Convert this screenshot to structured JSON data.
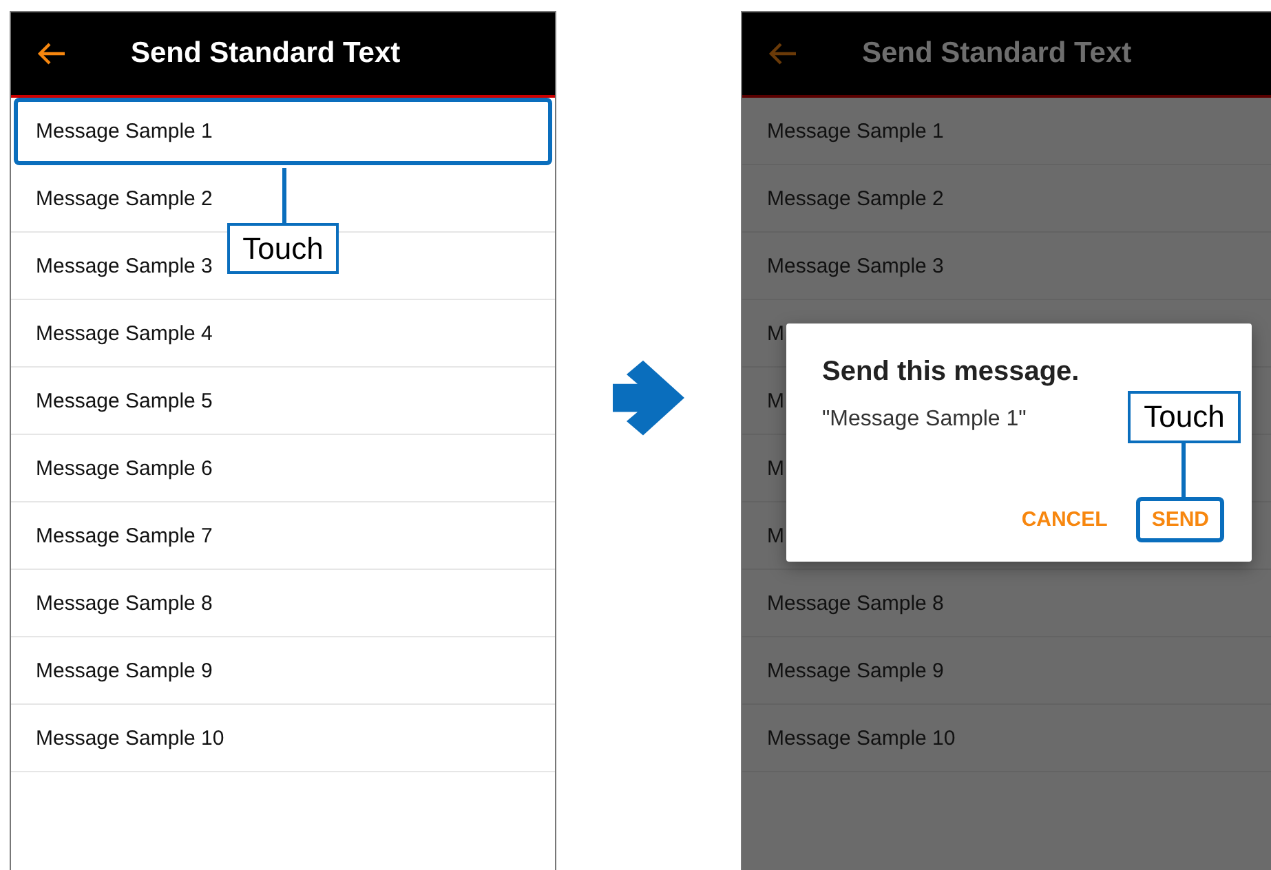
{
  "screens": [
    {
      "title": "Send Standard Text",
      "dimmed": false,
      "callout": "Touch",
      "items": [
        {
          "label": "Message Sample 1",
          "highlighted": true
        },
        {
          "label": "Message Sample 2",
          "highlighted": false
        },
        {
          "label": "Message Sample 3",
          "highlighted": false
        },
        {
          "label": "Message Sample 4",
          "highlighted": false
        },
        {
          "label": "Message Sample 5",
          "highlighted": false
        },
        {
          "label": "Message Sample 6",
          "highlighted": false
        },
        {
          "label": "Message Sample 7",
          "highlighted": false
        },
        {
          "label": "Message Sample 8",
          "highlighted": false
        },
        {
          "label": "Message Sample 9",
          "highlighted": false
        },
        {
          "label": "Message Sample 10",
          "highlighted": false
        }
      ]
    },
    {
      "title": "Send Standard Text",
      "dimmed": true,
      "items": [
        {
          "label": "Message Sample 1",
          "highlighted": false
        },
        {
          "label": "Message Sample 2",
          "highlighted": false
        },
        {
          "label": "Message Sample 3",
          "highlighted": false
        },
        {
          "label": "M",
          "highlighted": false
        },
        {
          "label": "M",
          "highlighted": false
        },
        {
          "label": "M",
          "highlighted": false
        },
        {
          "label": "M",
          "highlighted": false
        },
        {
          "label": "Message Sample 8",
          "highlighted": false
        },
        {
          "label": "Message Sample 9",
          "highlighted": false
        },
        {
          "label": "Message Sample 10",
          "highlighted": false
        }
      ],
      "dialog": {
        "title": "Send this message.",
        "body": "\"Message Sample 1\"",
        "callout": "Touch",
        "buttons": [
          {
            "label": "CANCEL",
            "highlighted": false
          },
          {
            "label": "SEND",
            "highlighted": true
          }
        ]
      }
    }
  ]
}
